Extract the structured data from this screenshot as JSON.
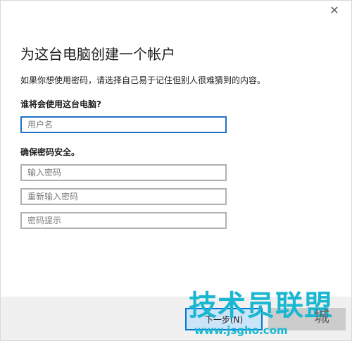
{
  "window": {
    "close_glyph": "✕"
  },
  "page": {
    "title": "为这台电脑创建一个帐户",
    "subtitle": "如果你想使用密码，请选择自己易于记住但别人很难猜到的内容。"
  },
  "form": {
    "who_label": "谁将会使用这台电脑?",
    "username_placeholder": "用户名",
    "username_value": "",
    "secure_label": "确保密码安全。",
    "password_placeholder": "输入密码",
    "password_confirm_placeholder": "重新输入密码",
    "password_hint_placeholder": "密码提示"
  },
  "footer": {
    "next_label": "下一步(N)",
    "back_label": ""
  },
  "watermark": {
    "main_text": "技术员联盟",
    "url_text": "www.jsgho.com",
    "right_text": "城"
  },
  "colors": {
    "focus_border": "#1e72c7",
    "field_border": "#b0b0b0",
    "watermark": "#19b7d1"
  },
  "icons": {
    "close": "close-icon"
  }
}
